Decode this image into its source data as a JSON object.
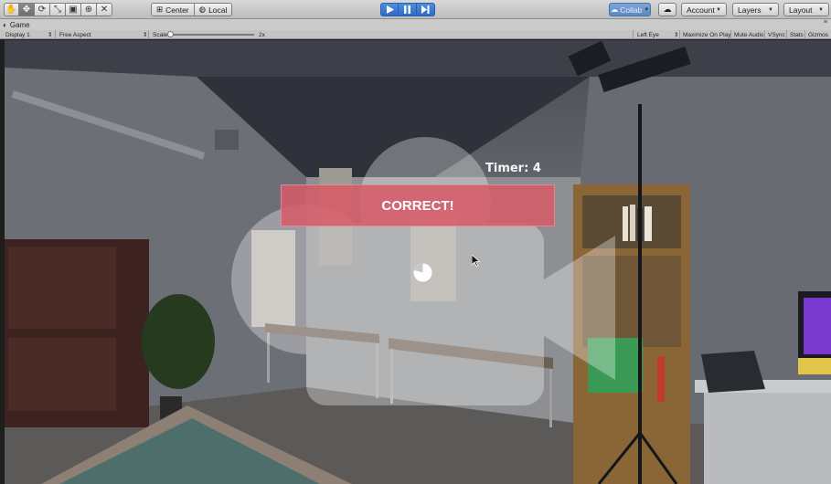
{
  "toolbar": {
    "transform_tools": [
      {
        "name": "hand-tool-icon",
        "glyph": "✋",
        "active": false
      },
      {
        "name": "move-tool-icon",
        "glyph": "✥",
        "active": true
      },
      {
        "name": "rotate-tool-icon",
        "glyph": "⟳",
        "active": false
      },
      {
        "name": "scale-tool-icon",
        "glyph": "⤡",
        "active": false
      },
      {
        "name": "rect-tool-icon",
        "glyph": "▣",
        "active": false
      },
      {
        "name": "transform-tool-icon",
        "glyph": "⊕",
        "active": false
      },
      {
        "name": "custom-tool-icon",
        "glyph": "✕",
        "active": false
      }
    ],
    "pivot_label": "Center",
    "space_label": "Local",
    "collab_label": "Collab",
    "account_label": "Account",
    "layers_label": "Layers",
    "layout_label": "Layout"
  },
  "game_tab": {
    "title": "Game"
  },
  "game_bar": {
    "display": "Display 1",
    "aspect": "Free Aspect",
    "scale_label": "Scale",
    "scale_value": "2x",
    "eye": "Left Eye",
    "maximize": "Maximize On Play",
    "mute": "Mute Audio",
    "vsync": "VSync",
    "stats": "Stats",
    "gizmos": "Gizmos"
  },
  "game": {
    "timer_text": "Timer: 4",
    "feedback_text": "CORRECT!"
  },
  "colors": {
    "play_blue": "#2c6cc7",
    "banner": "#d65c6a",
    "collab": "#5b89c4"
  }
}
